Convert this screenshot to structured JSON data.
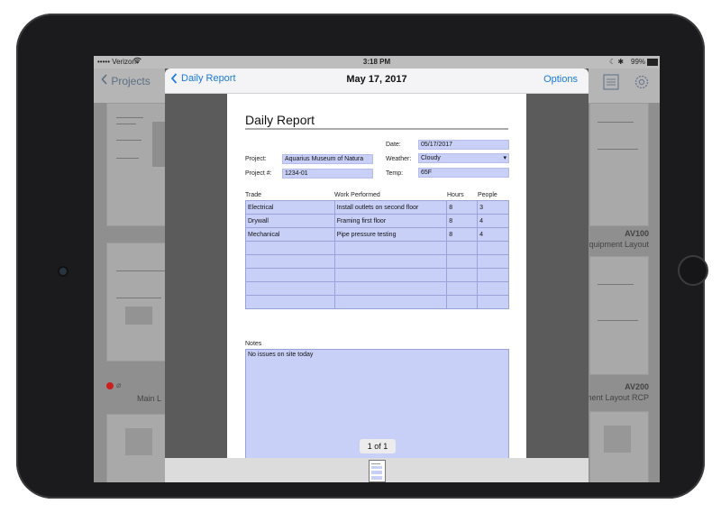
{
  "status_bar": {
    "carrier": "••••• Verizon",
    "time": "3:18 PM",
    "battery": "99%"
  },
  "background": {
    "back_label": "Projects",
    "sheets": [
      {
        "code": "AV100",
        "name": "quipment Layout"
      },
      {
        "code": "AV200",
        "name": "ment Layout RCP"
      }
    ],
    "left_label": "Main L"
  },
  "modal": {
    "back_label": "Daily Report",
    "title": "May 17, 2017",
    "options_label": "Options"
  },
  "document": {
    "title": "Daily Report",
    "project_label": "Project:",
    "project_value": "Aquarius Museum of Natura",
    "project_num_label": "Project #:",
    "project_num_value": "1234-01",
    "date_label": "Date:",
    "date_value": "05/17/2017",
    "weather_label": "Weather:",
    "weather_value": "Cloudy",
    "temp_label": "Temp:",
    "temp_value": "65F",
    "table_headers": [
      "Trade",
      "Work Performed",
      "Hours",
      "People"
    ],
    "rows": [
      [
        "Electrical",
        "Install outlets on second floor",
        "8",
        "3"
      ],
      [
        "Drywall",
        "Framing first floor",
        "8",
        "4"
      ],
      [
        "Mechanical",
        "Pipe pressure testing",
        "8",
        "4"
      ],
      [
        "",
        "",
        "",
        ""
      ],
      [
        "",
        "",
        "",
        ""
      ],
      [
        "",
        "",
        "",
        ""
      ],
      [
        "",
        "",
        "",
        ""
      ],
      [
        "",
        "",
        "",
        ""
      ]
    ],
    "notes_label": "Notes",
    "notes_value": "No issues on site today"
  },
  "pager": "1 of 1",
  "colors": {
    "accent": "#1a7ae0",
    "field": "#c9d0f8",
    "bezel": "#1b1b1d"
  }
}
